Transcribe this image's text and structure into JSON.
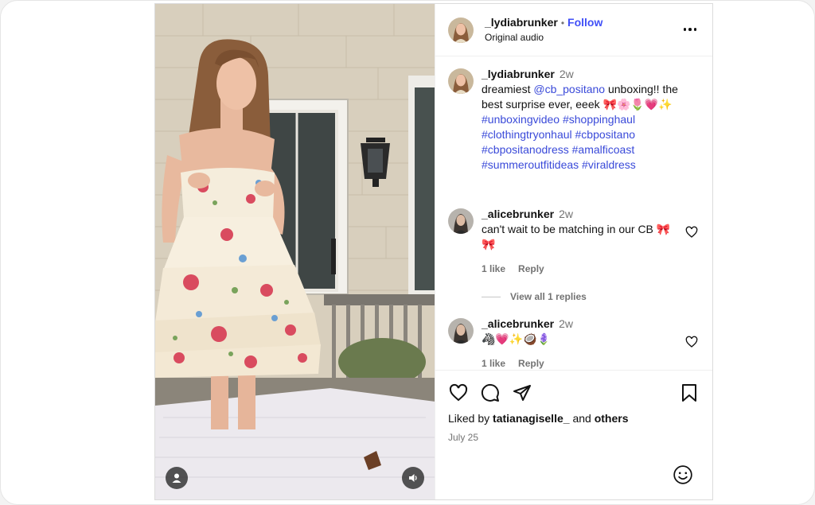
{
  "post": {
    "author": "_lydiabrunker",
    "follow_label": "Follow",
    "separator": "•",
    "audio_label": "Original audio",
    "caption": {
      "username": "_lydiabrunker",
      "time": "2w",
      "text_start": "dreamiest ",
      "mention": "@cb_positano",
      "text_end": " unboxing!! the best surprise ever, eeek 🎀🌸🌷💗✨",
      "hashtags": "#unboxingvideo #shoppinghaul #clothingtryonhaul #cbpositano #cbpositanodress #amalficoast #summeroutfitideas #viraldress"
    },
    "comments": [
      {
        "username": "_alicebrunker",
        "time": "2w",
        "text": "can't wait to be matching in our CB 🎀🎀",
        "likes": "1 like",
        "reply_label": "Reply",
        "view_replies": "View all 1 replies"
      },
      {
        "username": "_alicebrunker",
        "time": "2w",
        "text": "🦓💗✨🥥🪻",
        "likes": "1 like",
        "reply_label": "Reply"
      }
    ],
    "liked_by_prefix": "Liked by",
    "liked_by_user": "tatianagiselle_",
    "liked_by_and": "and",
    "liked_by_others": "others",
    "date": "July 25"
  },
  "icons": {
    "more": "more-options-icon",
    "like": "heart-icon",
    "comment": "comment-icon",
    "share": "share-icon",
    "save": "bookmark-icon",
    "emoji": "emoji-icon",
    "user_tag": "user-tag-icon",
    "sound": "speaker-icon"
  },
  "colors": {
    "follow": "#4150f7",
    "link": "#3a4ad9",
    "secondary_text": "#737373"
  }
}
